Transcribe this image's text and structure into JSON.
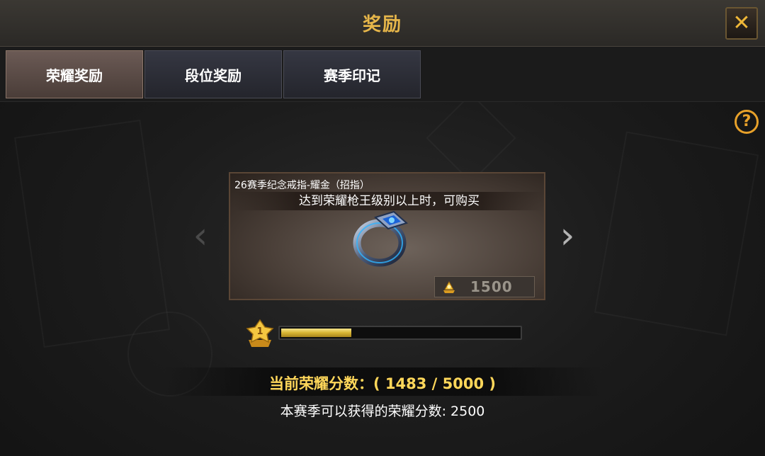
{
  "window": {
    "title": "奖励"
  },
  "tabs": [
    {
      "label": "荣耀奖励",
      "active": true
    },
    {
      "label": "段位奖励",
      "active": false
    },
    {
      "label": "赛季印记",
      "active": false
    }
  ],
  "reward_card": {
    "item_name": "26赛季纪念戒指-耀金（招指）",
    "condition": "达到荣耀枪王级别以上时，可购买",
    "price": "1500",
    "price_icon": "honor-coin-icon"
  },
  "progress": {
    "rank_badge_number": "1",
    "fill_ratio": 0.296,
    "current_score_text": "当前荣耀分数：( 1483 / 5000 )",
    "season_score_text": "本赛季可以获得的荣耀分数: 2500"
  },
  "colors": {
    "title_gold": "#e6b64a",
    "score_gold": "#ffd75a",
    "progress_fill": "#d8b533",
    "help_orange": "#e8a12a"
  }
}
